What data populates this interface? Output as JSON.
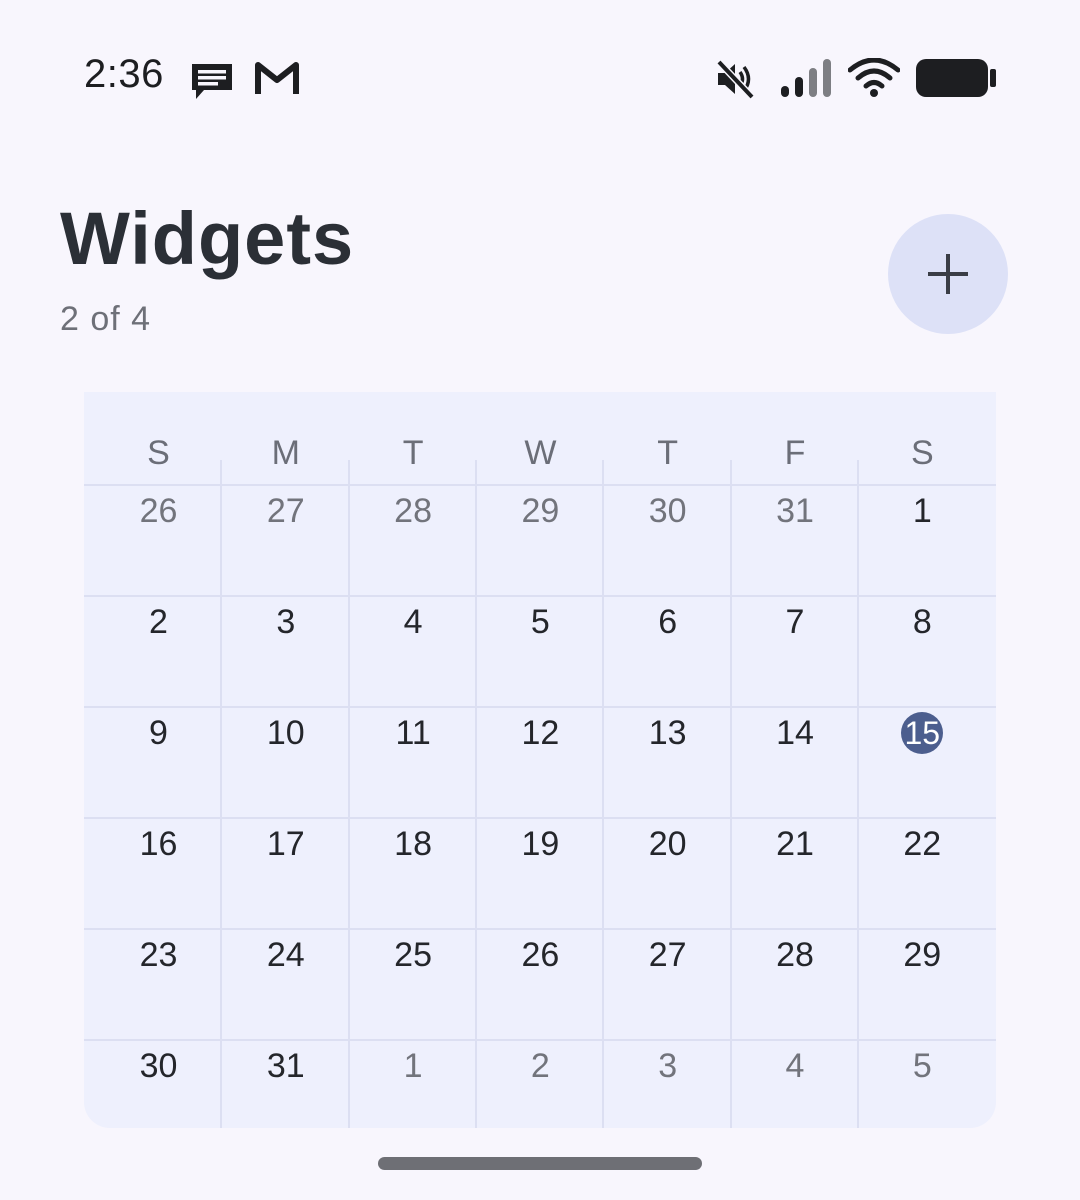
{
  "status_bar": {
    "time": "2:36",
    "left_icons": [
      "message-icon",
      "gmail-icon"
    ],
    "right_icons": [
      "mute-icon",
      "signal-icon",
      "wifi-icon",
      "battery-icon"
    ]
  },
  "header": {
    "title": "Widgets",
    "count": "2 of 4",
    "add_icon": "plus-icon"
  },
  "calendar": {
    "weekdays": [
      "S",
      "M",
      "T",
      "W",
      "T",
      "F",
      "S"
    ],
    "today": "15",
    "weeks": [
      [
        {
          "d": "26",
          "cur": false
        },
        {
          "d": "27",
          "cur": false
        },
        {
          "d": "28",
          "cur": false
        },
        {
          "d": "29",
          "cur": false
        },
        {
          "d": "30",
          "cur": false
        },
        {
          "d": "31",
          "cur": false
        },
        {
          "d": "1",
          "cur": true
        }
      ],
      [
        {
          "d": "2",
          "cur": true
        },
        {
          "d": "3",
          "cur": true
        },
        {
          "d": "4",
          "cur": true
        },
        {
          "d": "5",
          "cur": true
        },
        {
          "d": "6",
          "cur": true
        },
        {
          "d": "7",
          "cur": true
        },
        {
          "d": "8",
          "cur": true
        }
      ],
      [
        {
          "d": "9",
          "cur": true
        },
        {
          "d": "10",
          "cur": true
        },
        {
          "d": "11",
          "cur": true
        },
        {
          "d": "12",
          "cur": true
        },
        {
          "d": "13",
          "cur": true
        },
        {
          "d": "14",
          "cur": true
        },
        {
          "d": "15",
          "cur": true
        }
      ],
      [
        {
          "d": "16",
          "cur": true
        },
        {
          "d": "17",
          "cur": true
        },
        {
          "d": "18",
          "cur": true
        },
        {
          "d": "19",
          "cur": true
        },
        {
          "d": "20",
          "cur": true
        },
        {
          "d": "21",
          "cur": true
        },
        {
          "d": "22",
          "cur": true
        }
      ],
      [
        {
          "d": "23",
          "cur": true
        },
        {
          "d": "24",
          "cur": true
        },
        {
          "d": "25",
          "cur": true
        },
        {
          "d": "26",
          "cur": true
        },
        {
          "d": "27",
          "cur": true
        },
        {
          "d": "28",
          "cur": true
        },
        {
          "d": "29",
          "cur": true
        }
      ],
      [
        {
          "d": "30",
          "cur": true
        },
        {
          "d": "31",
          "cur": true
        },
        {
          "d": "1",
          "cur": false
        },
        {
          "d": "2",
          "cur": false
        },
        {
          "d": "3",
          "cur": false
        },
        {
          "d": "4",
          "cur": false
        },
        {
          "d": "5",
          "cur": false
        }
      ]
    ]
  },
  "colors": {
    "background": "#f8f6fd",
    "calendar_bg": "#eef0fd",
    "today_circle": "#4c5e8e",
    "add_button_bg": "#dde1f7"
  }
}
